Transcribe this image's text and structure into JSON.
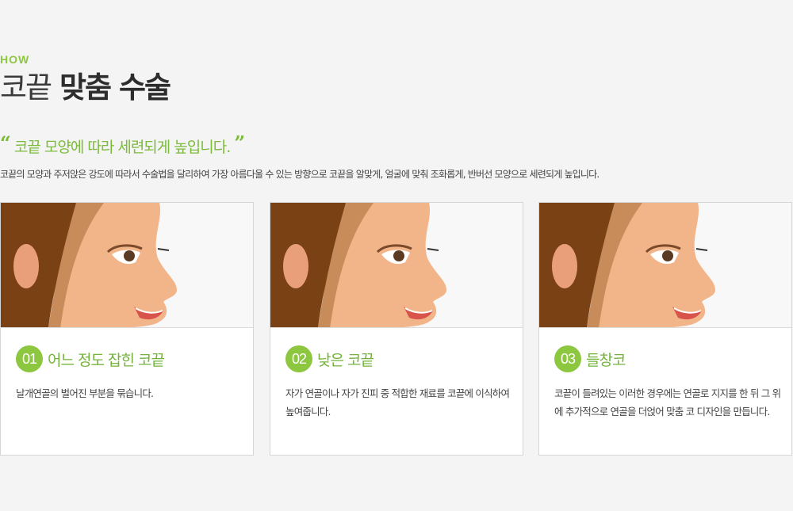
{
  "header": {
    "eyebrow": "HOW",
    "title_light": "코끝",
    "title_bold": "맞춤 수술",
    "quote_open": "“",
    "quote_text": "코끝 모양에 따라 세련되게 높입니다.",
    "quote_close": "”",
    "description": "코끝의 모양과 주저앉은 강도에 따라서 수술법을 달리하여 가장 아름다울 수 있는 방향으로 코끝을 알맞게, 얼굴에 맞춰 조화롭게, 반버선 모양으로 세련되게 높입니다."
  },
  "colors": {
    "accent": "#8dc63f",
    "hair": "#7a4214",
    "skin": "#f2b489",
    "lips": "#d8544a"
  },
  "cards": [
    {
      "num": "01",
      "title": "어느 정도 잡힌 코끝",
      "text": "날개연골의 벌어진 부분을 묶습니다.",
      "illustration": "woman-profile-nose"
    },
    {
      "num": "02",
      "title": "낮은 코끝",
      "text": "자가 연골이나 자가 진피 중 적합한 재료를 코끝에 이식하여 높여줍니다.",
      "illustration": "woman-profile-nose"
    },
    {
      "num": "03",
      "title": "들창코",
      "text": "코끝이 들려있는 이러한 경우에는 연골로 지지를 한 뒤 그 위에 추가적으로 연골을 더얹어 맞춤 코 디자인을 만듭니다.",
      "illustration": "woman-profile-nose"
    }
  ]
}
